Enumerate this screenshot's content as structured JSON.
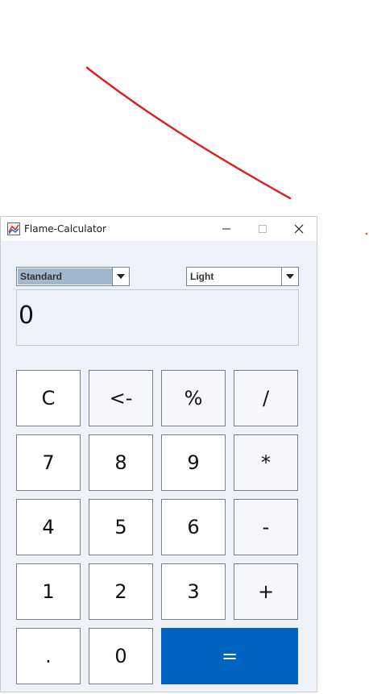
{
  "window": {
    "title": "Flame-Calculator"
  },
  "controls": {
    "mode": "Standard",
    "theme": "Light"
  },
  "display": {
    "value": "0"
  },
  "keys": {
    "clear": "C",
    "backspace": "<-",
    "percent": "%",
    "divide": "/",
    "seven": "7",
    "eight": "8",
    "nine": "9",
    "multiply": "*",
    "four": "4",
    "five": "5",
    "six": "6",
    "subtract": "-",
    "one": "1",
    "two": "2",
    "three": "3",
    "add": "+",
    "decimal": ".",
    "zero": "0",
    "equals": "="
  },
  "colors": {
    "accent": "#0063bf",
    "annotation_stroke": "#dd2222",
    "window_background": "#eef1f8",
    "selected_combo_background": "#a3b8cc"
  },
  "icons": {
    "app": "calculator-app-icon",
    "minimize": "minimize-icon",
    "maximize": "maximize-icon",
    "close": "close-icon",
    "combo_arrow": "chevron-down-icon"
  }
}
